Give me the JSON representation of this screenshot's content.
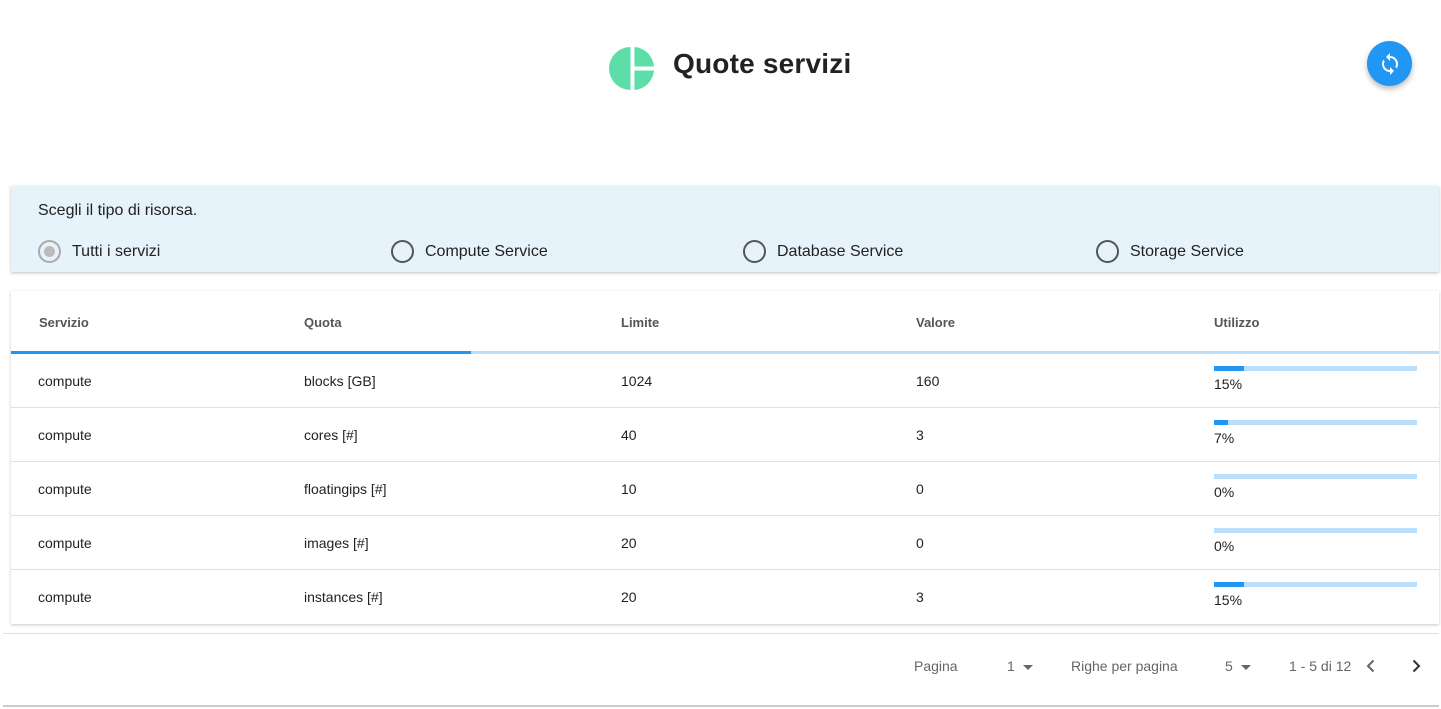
{
  "header": {
    "title": "Quote servizi",
    "logo_icon": "pie-chart-icon",
    "logo_color": "#5ddea8",
    "refresh_icon": "refresh-icon",
    "accent": "#2196f3"
  },
  "filter": {
    "label": "Scegli il tipo di risorsa.",
    "selected": "Tutti i servizi",
    "options": [
      {
        "label": "Tutti i servizi",
        "checked": true
      },
      {
        "label": "Compute Service",
        "checked": false
      },
      {
        "label": "Database Service",
        "checked": false
      },
      {
        "label": "Storage Service",
        "checked": false
      }
    ]
  },
  "table": {
    "columns": [
      "Servizio",
      "Quota",
      "Limite",
      "Valore",
      "Utilizzo"
    ],
    "rows": [
      {
        "servizio": "compute",
        "quota": "blocks [GB]",
        "limite": "1024",
        "valore": "160",
        "utilizzo": "15%",
        "fraction": 0.15
      },
      {
        "servizio": "compute",
        "quota": "cores [#]",
        "limite": "40",
        "valore": "3",
        "utilizzo": "7%",
        "fraction": 0.07
      },
      {
        "servizio": "compute",
        "quota": "floatingips [#]",
        "limite": "10",
        "valore": "0",
        "utilizzo": "0%",
        "fraction": 0.0
      },
      {
        "servizio": "compute",
        "quota": "images [#]",
        "limite": "20",
        "valore": "0",
        "utilizzo": "0%",
        "fraction": 0.0
      },
      {
        "servizio": "compute",
        "quota": "instances [#]",
        "limite": "20",
        "valore": "3",
        "utilizzo": "15%",
        "fraction": 0.15
      }
    ]
  },
  "pagination": {
    "page_label": "Pagina",
    "page_value": "1",
    "rows_label": "Righe per pagina",
    "rows_value": "5",
    "range_text": "1 - 5 di 12",
    "prev_icon": "chevron-left-icon",
    "next_icon": "chevron-right-icon"
  }
}
